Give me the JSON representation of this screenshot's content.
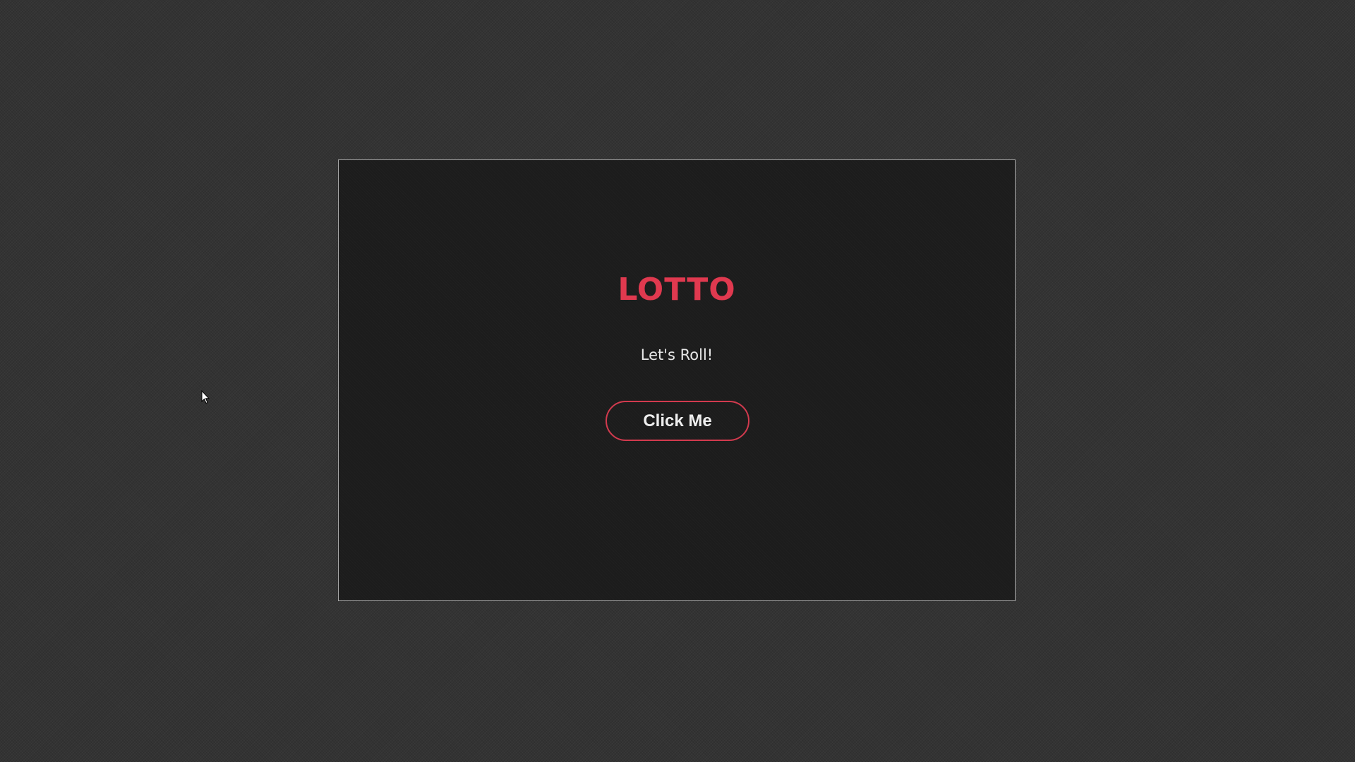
{
  "colors": {
    "page_background": "#333333",
    "card_background": "#1c1c1c",
    "card_border": "#a8a8a8",
    "accent": "#e0394f",
    "button_border": "#d23a4e",
    "text_light": "#eeeeee"
  },
  "card": {
    "title": "LOTTO",
    "subtitle": "Let's Roll!",
    "button_label": "Click Me"
  },
  "cursor": {
    "icon": "mouse-pointer-icon"
  }
}
